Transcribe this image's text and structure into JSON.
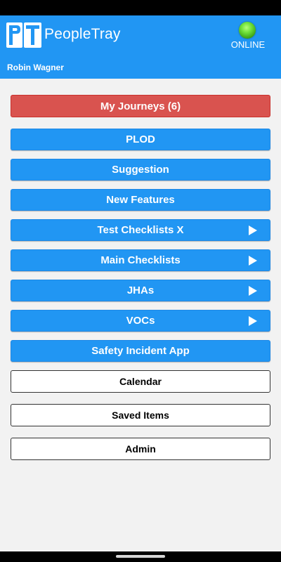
{
  "header": {
    "logo_text": "PT",
    "brand": "PeopleTray",
    "status": "ONLINE",
    "status_color": "#3aa017",
    "user": "Robin Wagner"
  },
  "menu": {
    "my_journeys": "My Journeys (6)",
    "plod": "PLOD",
    "suggestion": "Suggestion",
    "new_features": "New Features",
    "test_checklists": "Test Checklists X",
    "main_checklists": "Main Checklists",
    "jhas": "JHAs",
    "vocs": "VOCs",
    "safety_incident": "Safety Incident App",
    "calendar": "Calendar",
    "saved_items": "Saved Items",
    "admin": "Admin"
  },
  "colors": {
    "header_blue": "#2196f3",
    "journeys_red": "#d9534f",
    "background": "#f2f2f2"
  }
}
